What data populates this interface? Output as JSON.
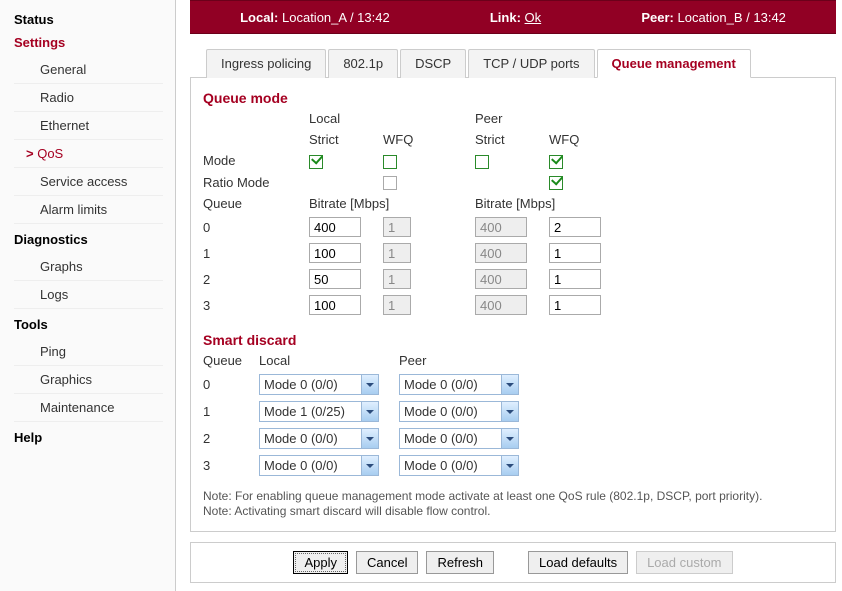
{
  "sidebar": {
    "sections": [
      {
        "label": "Status",
        "active": false,
        "items": []
      },
      {
        "label": "Settings",
        "active": true,
        "items": [
          {
            "label": "General"
          },
          {
            "label": "Radio"
          },
          {
            "label": "Ethernet"
          },
          {
            "label": "QoS",
            "active": true
          },
          {
            "label": "Service access"
          },
          {
            "label": "Alarm limits"
          }
        ]
      },
      {
        "label": "Diagnostics",
        "active": false,
        "items": [
          {
            "label": "Graphs"
          },
          {
            "label": "Logs"
          }
        ]
      },
      {
        "label": "Tools",
        "active": false,
        "items": [
          {
            "label": "Ping"
          },
          {
            "label": "Graphics"
          },
          {
            "label": "Maintenance"
          }
        ]
      },
      {
        "label": "Help",
        "active": false,
        "items": []
      }
    ]
  },
  "topbar": {
    "local_label": "Local:",
    "local_value": "Location_A / 13:42",
    "link_label": "Link:",
    "link_value": "Ok",
    "peer_label": "Peer:",
    "peer_value": "Location_B / 13:42"
  },
  "tabs": [
    {
      "label": "Ingress policing"
    },
    {
      "label": "802.1p"
    },
    {
      "label": "DSCP"
    },
    {
      "label": "TCP / UDP ports"
    },
    {
      "label": "Queue management",
      "active": true
    }
  ],
  "queue_mode": {
    "title": "Queue mode",
    "headers": {
      "local": "Local",
      "peer": "Peer",
      "strict": "Strict",
      "wfq": "WFQ"
    },
    "rows": {
      "mode_label": "Mode",
      "ratio_label": "Ratio Mode",
      "mode": {
        "local_strict": true,
        "local_wfq": false,
        "peer_strict": false,
        "peer_wfq": true
      },
      "ratio": {
        "local_wfq": false,
        "peer_wfq": true
      }
    },
    "queue_header": "Queue",
    "bitrate_header": "Bitrate [Mbps]",
    "queues": [
      {
        "id": "0",
        "local_rate": "400",
        "local_ratio": "1",
        "peer_rate": "400",
        "peer_ratio": "2"
      },
      {
        "id": "1",
        "local_rate": "100",
        "local_ratio": "1",
        "peer_rate": "400",
        "peer_ratio": "1"
      },
      {
        "id": "2",
        "local_rate": "50",
        "local_ratio": "1",
        "peer_rate": "400",
        "peer_ratio": "1"
      },
      {
        "id": "3",
        "local_rate": "100",
        "local_ratio": "1",
        "peer_rate": "400",
        "peer_ratio": "1"
      }
    ]
  },
  "smart_discard": {
    "title": "Smart discard",
    "headers": {
      "queue": "Queue",
      "local": "Local",
      "peer": "Peer"
    },
    "rows": [
      {
        "id": "0",
        "local": "Mode 0 (0/0)",
        "peer": "Mode 0 (0/0)"
      },
      {
        "id": "1",
        "local": "Mode 1 (0/25)",
        "peer": "Mode 0 (0/0)"
      },
      {
        "id": "2",
        "local": "Mode 0 (0/0)",
        "peer": "Mode 0 (0/0)"
      },
      {
        "id": "3",
        "local": "Mode 0 (0/0)",
        "peer": "Mode 0 (0/0)"
      }
    ]
  },
  "notes": {
    "line1": "Note: For enabling queue management mode activate at least one QoS rule (802.1p, DSCP, port priority).",
    "line2": "Note: Activating smart discard will disable flow control."
  },
  "actions": {
    "apply": "Apply",
    "cancel": "Cancel",
    "refresh": "Refresh",
    "load_defaults": "Load defaults",
    "load_custom": "Load custom"
  }
}
